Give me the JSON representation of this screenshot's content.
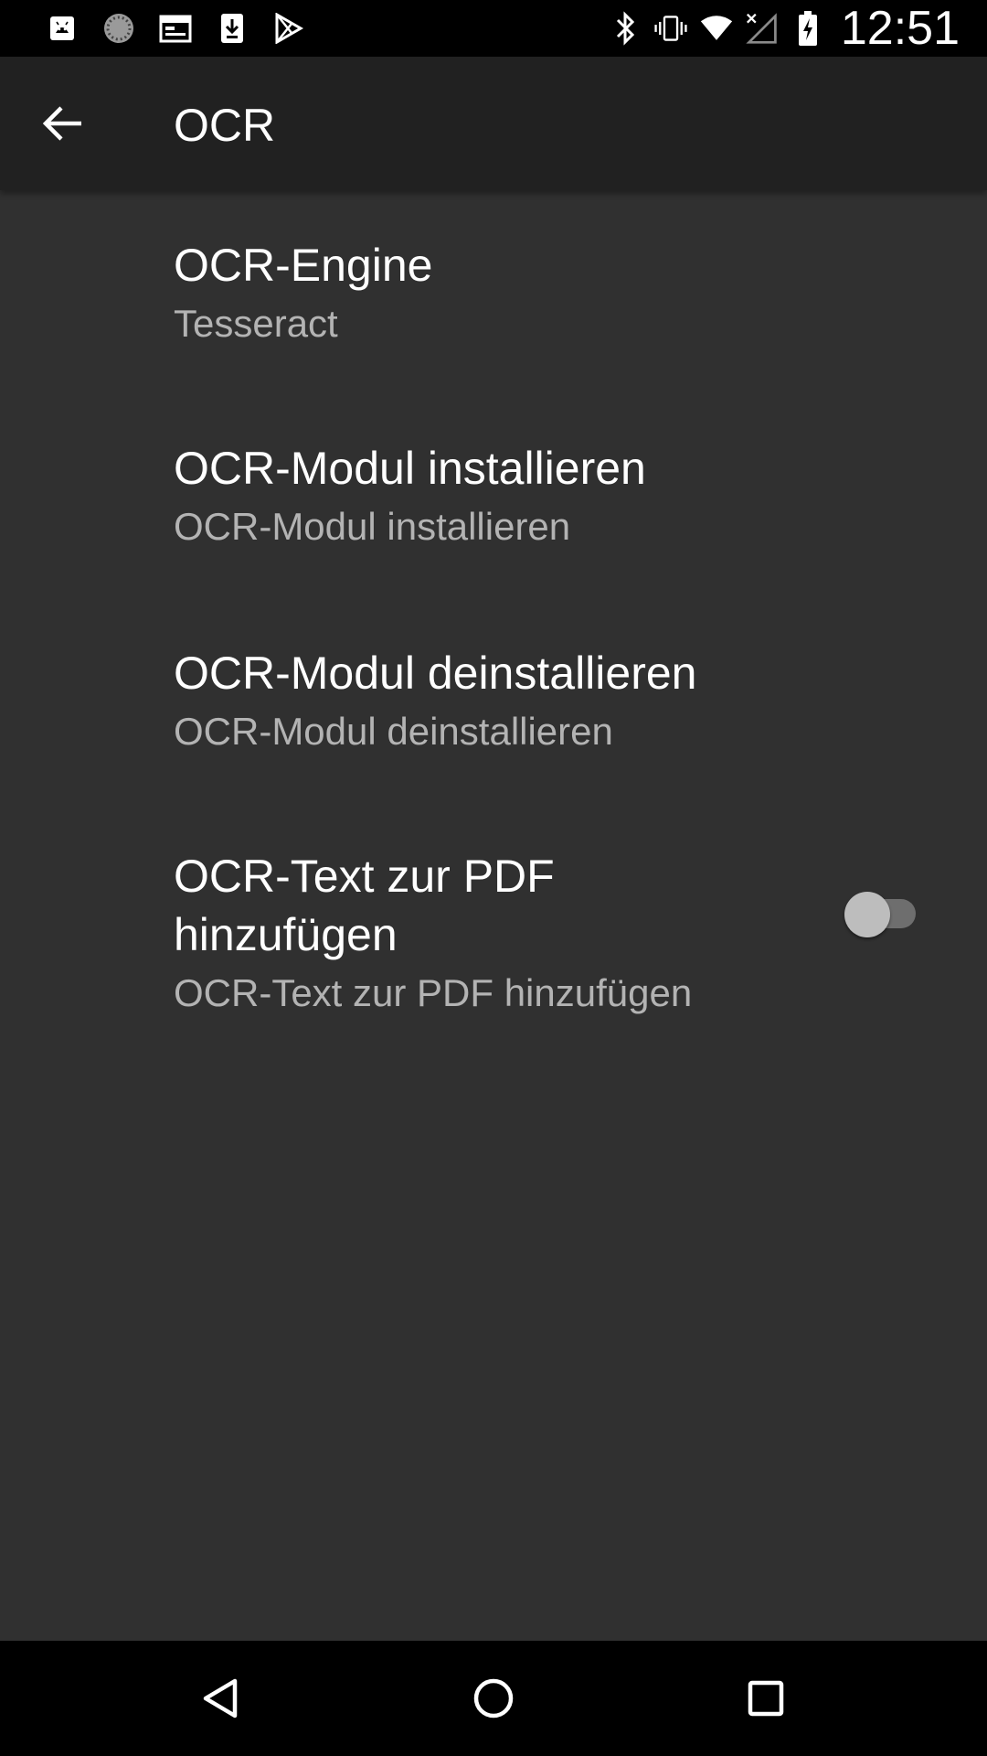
{
  "status_bar": {
    "time": "12:51",
    "left_icons": [
      "android-debug-icon",
      "sync-spinner-icon",
      "calendar-icon",
      "download-icon",
      "play-store-icon"
    ],
    "right_icons": [
      "bluetooth-icon",
      "vibrate-icon",
      "wifi-icon",
      "no-signal-icon",
      "battery-charging-icon"
    ]
  },
  "app_bar": {
    "title": "OCR",
    "back_icon": "arrow-back-icon"
  },
  "preferences": [
    {
      "title": "OCR-Engine",
      "summary": "Tesseract"
    },
    {
      "title": "OCR-Modul installieren",
      "summary": "OCR-Modul installieren"
    },
    {
      "title": "OCR-Modul deinstallieren",
      "summary": "OCR-Modul deinstallieren"
    },
    {
      "title": "OCR-Text zur PDF hinzufügen",
      "summary": "OCR-Text zur PDF hinzufügen",
      "toggle_on": false
    }
  ],
  "nav_bar": [
    "back-triangle-icon",
    "home-circle-icon",
    "recents-square-icon"
  ],
  "colors": {
    "background": "#303030",
    "app_bar": "#212121",
    "status_bar": "#000000",
    "summary_text": "#b3b3b3",
    "toggle_thumb_off": "#bdbdbd",
    "toggle_track_off": "#6e6e6e"
  }
}
